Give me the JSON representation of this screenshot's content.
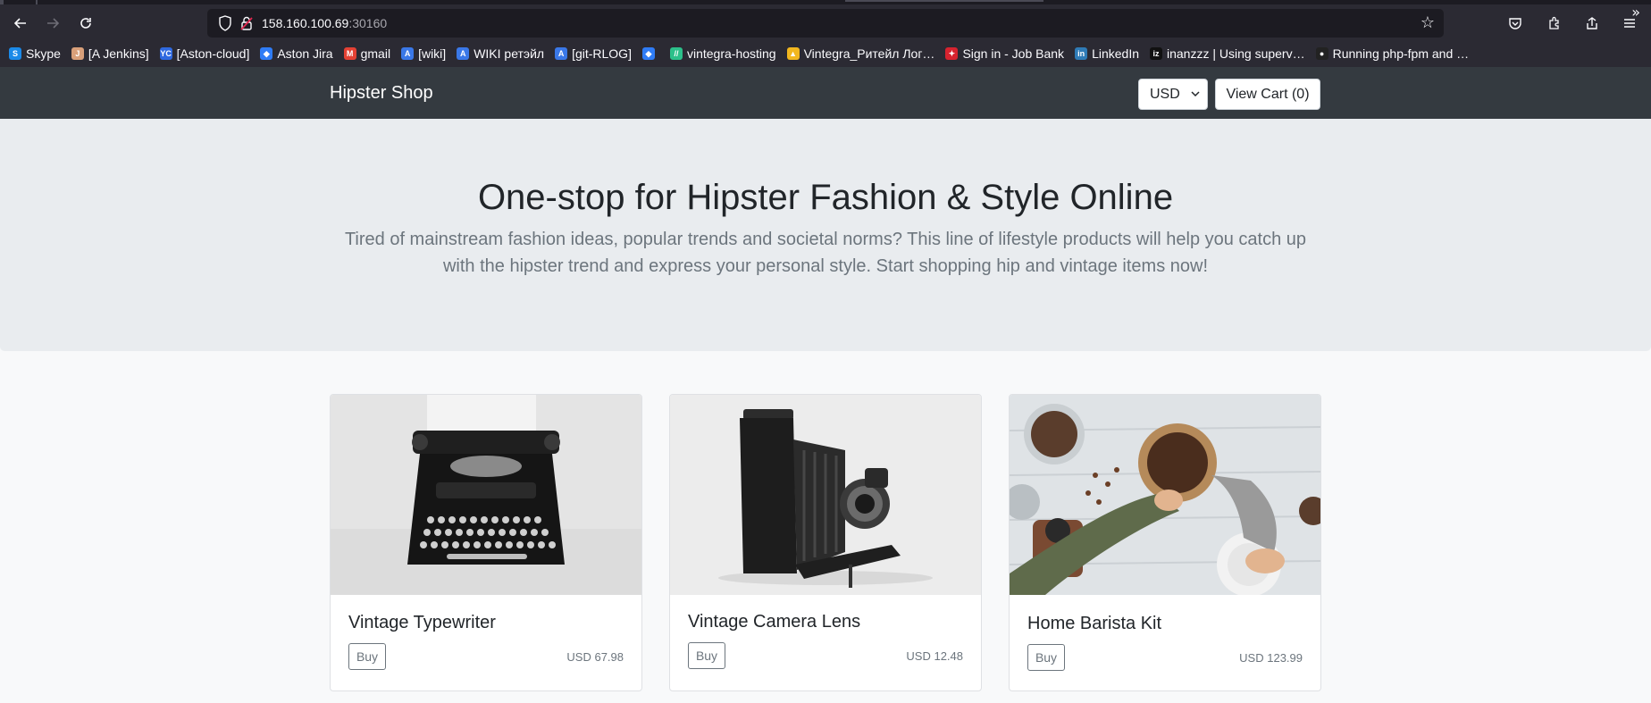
{
  "browser": {
    "url_host": "158.160.100.69",
    "url_port": ":30160",
    "bookmarks": [
      {
        "label": "Skype",
        "icon": "skype-icon",
        "color": "#1b8ae8",
        "glyph": "S"
      },
      {
        "label": "[A Jenkins]",
        "icon": "jenkins-icon",
        "color": "#d9a07a",
        "glyph": "J"
      },
      {
        "label": "[Aston-cloud]",
        "icon": "yandex-cloud-icon",
        "color": "#2f69e0",
        "glyph": "YC"
      },
      {
        "label": "Aston Jira",
        "icon": "jira-icon",
        "color": "#2f7cf6",
        "glyph": "◆"
      },
      {
        "label": "gmail",
        "icon": "gmail-icon",
        "color": "#e44134",
        "glyph": "M"
      },
      {
        "label": "[wiki]",
        "icon": "confluence-icon",
        "color": "#3a78e8",
        "glyph": "A"
      },
      {
        "label": "WIKI ретэйл",
        "icon": "confluence-icon",
        "color": "#3a78e8",
        "glyph": "A"
      },
      {
        "label": "[git-RLOG]",
        "icon": "confluence-icon",
        "color": "#3a78e8",
        "glyph": "A"
      },
      {
        "label": "",
        "icon": "jira-icon",
        "color": "#2f7cf6",
        "glyph": "◆"
      },
      {
        "label": "vintegra-hosting",
        "icon": "hosting-icon",
        "color": "#2cc08a",
        "glyph": "//"
      },
      {
        "label": "Vintegra_Ритейл Лог…",
        "icon": "google-drive-icon",
        "color": "#f2b71f",
        "glyph": "▲"
      },
      {
        "label": "Sign in - Job Bank",
        "icon": "canada-leaf-icon",
        "color": "#d6232f",
        "glyph": "✦"
      },
      {
        "label": "LinkedIn",
        "icon": "linkedin-icon",
        "color": "#2f7bb6",
        "glyph": "in"
      },
      {
        "label": "inanzzz | Using superv…",
        "icon": "inanzzz-icon",
        "color": "#111111",
        "glyph": "iz"
      },
      {
        "label": "Running php-fpm and …",
        "icon": "github-icon",
        "color": "#222222",
        "glyph": "●"
      }
    ]
  },
  "header": {
    "brand": "Hipster Shop",
    "currency": "USD",
    "view_cart": "View Cart (0)"
  },
  "hero": {
    "title": "One-stop for Hipster Fashion & Style Online",
    "lead": "Tired of mainstream fashion ideas, popular trends and societal norms? This line of lifestyle products will help you catch up with the hipster trend and express your personal style. Start shopping hip and vintage items now!"
  },
  "products": [
    {
      "name": "Vintage Typewriter",
      "buy": "Buy",
      "price": "USD 67.98"
    },
    {
      "name": "Vintage Camera Lens",
      "buy": "Buy",
      "price": "USD 12.48"
    },
    {
      "name": "Home Barista Kit",
      "buy": "Buy",
      "price": "USD 123.99"
    }
  ]
}
